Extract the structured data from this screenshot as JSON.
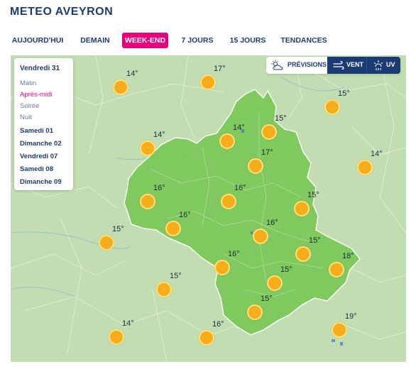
{
  "page": {
    "title": "METEO AVEYRON"
  },
  "tabs": [
    {
      "label": "AUJOURD'HUI"
    },
    {
      "label": "DEMAIN"
    },
    {
      "label": "WEEK-END"
    },
    {
      "label": "7 JOURS"
    },
    {
      "label": "15 JOURS"
    },
    {
      "label": "TENDANCES"
    }
  ],
  "active_tab": "WEEK-END",
  "panel": {
    "day_header": "Vendredi 31",
    "periods": [
      {
        "label": "Matin"
      },
      {
        "label": "Après-midi"
      },
      {
        "label": "Soirée"
      },
      {
        "label": "Nuit"
      }
    ],
    "active_period": "Après-midi",
    "days": [
      {
        "label": "Samedi 01"
      },
      {
        "label": "Dimanche 02"
      },
      {
        "label": "Vendredi 07"
      },
      {
        "label": "Samedi 08"
      },
      {
        "label": "Dimanche 09"
      }
    ]
  },
  "mode_switch": {
    "previsions": "PRÉVISIONS",
    "vent": "VENT",
    "uv": "UV",
    "active": "PRÉVISIONS"
  },
  "colors": {
    "brand": "#1d3b73",
    "accent": "#e6007e",
    "region_fill": "#7cc85a",
    "surroundings": "#c3ddb3",
    "sun": "#f6ad1b"
  },
  "markers": [
    {
      "temp": "14°",
      "condition": "sun-icon"
    },
    {
      "temp": "17°",
      "condition": "sun-icon"
    },
    {
      "temp": "15°",
      "condition": "sun-icon"
    },
    {
      "temp": "15°",
      "condition": "sun-icon"
    },
    {
      "temp": "14°",
      "condition": "sun-icon"
    },
    {
      "temp": "14°",
      "condition": "sun-icon"
    },
    {
      "temp": "17°",
      "condition": "sun-icon"
    },
    {
      "temp": "14°",
      "condition": "sun-icon"
    },
    {
      "temp": "16°",
      "condition": "sun-icon"
    },
    {
      "temp": "16°",
      "condition": "sun-icon"
    },
    {
      "temp": "15°",
      "condition": "sun-icon"
    },
    {
      "temp": "16°",
      "condition": "sun-icon"
    },
    {
      "temp": "15°",
      "condition": "sun-icon"
    },
    {
      "temp": "16°",
      "condition": "sun-icon"
    },
    {
      "temp": "15°",
      "condition": "sun-icon"
    },
    {
      "temp": "16°",
      "condition": "sun-icon"
    },
    {
      "temp": "18°",
      "condition": "sun-icon"
    },
    {
      "temp": "15°",
      "condition": "sun-icon"
    },
    {
      "temp": "15°",
      "condition": "sun-icon"
    },
    {
      "temp": "15°",
      "condition": "sun-icon"
    },
    {
      "temp": "14°",
      "condition": "sun-icon"
    },
    {
      "temp": "16°",
      "condition": "sun-icon"
    },
    {
      "temp": "19°",
      "condition": "sun-icon"
    }
  ]
}
